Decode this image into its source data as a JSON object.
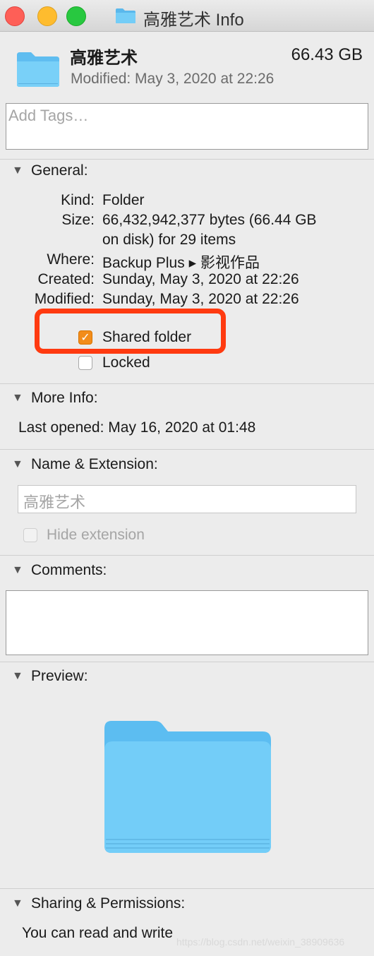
{
  "window": {
    "title": "高雅艺术 Info",
    "traffic_lights": {
      "close": "#fe5f57",
      "minimize": "#febc2e",
      "zoom": "#28c840"
    }
  },
  "header": {
    "name": "高雅艺术",
    "size": "66.43 GB",
    "modified": "Modified: May 3, 2020 at 22:26",
    "icon": "folder-icon"
  },
  "tags": {
    "placeholder": "Add Tags…"
  },
  "general": {
    "title": "General:",
    "rows": [
      {
        "label": "Kind:",
        "value": "Folder"
      },
      {
        "label": "Size:",
        "value": "66,432,942,377 bytes (66.44 GB",
        "value2": "on disk) for 29 items"
      },
      {
        "label": "Where:",
        "value": "Backup Plus ▸ 影视作品"
      },
      {
        "label": "Created:",
        "value": "Sunday, May 3, 2020 at 22:26"
      },
      {
        "label": "Modified:",
        "value": "Sunday, May 3, 2020 at 22:26"
      }
    ],
    "shared_folder": {
      "label": "Shared folder",
      "checked": true
    },
    "locked": {
      "label": "Locked",
      "checked": false
    }
  },
  "more_info": {
    "title": "More Info:",
    "last_opened": "Last opened: May 16, 2020 at 01:48"
  },
  "name_extension": {
    "title": "Name & Extension:",
    "value": "高雅艺术",
    "hide_extension": "Hide extension"
  },
  "comments": {
    "title": "Comments:",
    "value": ""
  },
  "preview": {
    "title": "Preview:"
  },
  "sharing": {
    "title": "Sharing & Permissions:",
    "text": "You can read and write"
  },
  "watermark": "https://blog.csdn.net/weixin_38909636",
  "colors": {
    "highlight": "#ff3a10",
    "checkbox": "#f28c1a",
    "folder": "#6ccaf6"
  }
}
